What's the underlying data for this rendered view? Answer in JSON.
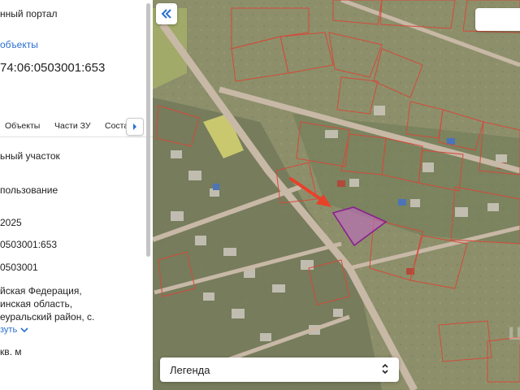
{
  "panel": {
    "portal_title": "нный портал",
    "objects_link": "объекты",
    "cadastral_number": "74:06:0503001:653",
    "tabs": [
      "Объекты",
      "Части ЗУ",
      "Соста"
    ],
    "fields": {
      "type": "ьный участок",
      "usage": "пользование",
      "year": "2025",
      "cad_number": "0503001:653",
      "quarter": "0503001",
      "address_line1": "йская Федерация,",
      "address_line2": "инская область,",
      "address_line3": "еуральский район, с.",
      "more_link": "зуть",
      "area_unit": "кв. м"
    }
  },
  "map": {
    "legend_label": "Легенда",
    "collapse_icon": "double-chevron-left-icon",
    "legend_icon": "up-down-chevron-icon",
    "parcel_color": "#d44a3a",
    "selected_parcel_color": "#b03aa0",
    "arrow_color": "#e8412a",
    "watermark": "циан"
  }
}
